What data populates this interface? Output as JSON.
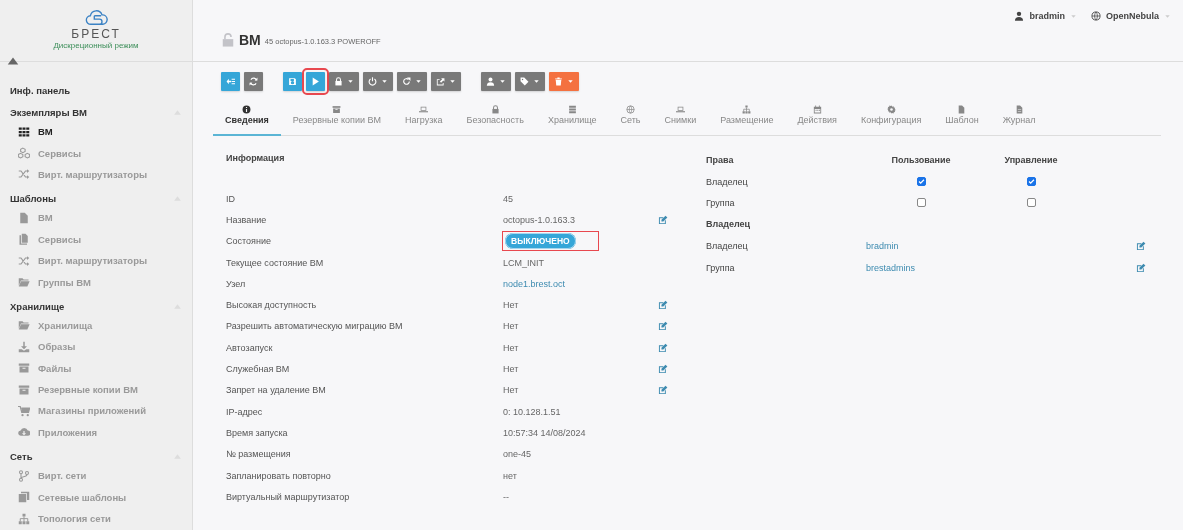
{
  "sidebar": {
    "brand": "БРЕСТ",
    "mode": "Дискреционный режим",
    "items": [
      {
        "label": "Инф. панель"
      },
      {
        "label": "Экземпляры ВМ",
        "children": [
          {
            "label": "ВМ",
            "kind": "grid",
            "selected": true
          },
          {
            "label": "Сервисы",
            "kind": "cubes",
            "selected": false
          },
          {
            "label": "Вирт. маршрутизаторы",
            "kind": "shuffle",
            "selected": false
          }
        ]
      },
      {
        "label": "Шаблоны",
        "children": [
          {
            "label": "ВМ",
            "kind": "file",
            "selected": false
          },
          {
            "label": "Сервисы",
            "kind": "files",
            "selected": false
          },
          {
            "label": "Вирт. маршрутизаторы",
            "kind": "shuffle",
            "selected": false
          },
          {
            "label": "Группы ВМ",
            "kind": "folder",
            "selected": false
          }
        ]
      },
      {
        "label": "Хранилище",
        "children": [
          {
            "label": "Хранилища",
            "kind": "folder",
            "selected": false
          },
          {
            "label": "Образы",
            "kind": "download",
            "selected": false
          },
          {
            "label": "Файлы",
            "kind": "archive",
            "selected": false
          },
          {
            "label": "Резервные копии ВМ",
            "kind": "archive",
            "selected": false
          },
          {
            "label": "Магазины приложений",
            "kind": "cart",
            "selected": false
          },
          {
            "label": "Приложения",
            "kind": "cloud",
            "selected": false
          }
        ]
      },
      {
        "label": "Сеть",
        "children": [
          {
            "label": "Вирт. сети",
            "kind": "branch",
            "selected": false
          },
          {
            "label": "Сетевые шаблоны",
            "kind": "copy",
            "selected": false
          },
          {
            "label": "Топология сети",
            "kind": "sitemap",
            "selected": false
          }
        ]
      }
    ]
  },
  "header": {
    "user": "bradmin",
    "zone": "OpenNebula"
  },
  "title": {
    "name": "ВМ",
    "subtitle": "45 octopus-1.0.163.3 POWEROFF"
  },
  "toolbar": [
    [
      {
        "kind": "back",
        "dropdown": false,
        "highlighted": false
      },
      {
        "kind": "refresh",
        "dropdown": false,
        "highlighted": false
      }
    ],
    [
      {
        "kind": "save",
        "dropdown": false,
        "highlighted": false
      },
      {
        "kind": "play",
        "dropdown": false,
        "highlighted": true
      },
      {
        "kind": "lock",
        "dropdown": true,
        "highlighted": false
      },
      {
        "kind": "power",
        "dropdown": true,
        "highlighted": false
      },
      {
        "kind": "redo",
        "dropdown": true,
        "highlighted": false
      },
      {
        "kind": "export",
        "dropdown": true,
        "highlighted": false
      }
    ],
    [
      {
        "kind": "user",
        "dropdown": true,
        "highlighted": false
      },
      {
        "kind": "tags",
        "dropdown": true,
        "highlighted": false
      },
      {
        "kind": "trash",
        "dropdown": true,
        "highlighted": false
      }
    ]
  ],
  "tabs": [
    {
      "label": "Сведения",
      "kind": "info",
      "selected": true
    },
    {
      "label": "Резервные копии ВМ",
      "kind": "archive",
      "selected": false
    },
    {
      "label": "Нагрузка",
      "kind": "laptop",
      "selected": false
    },
    {
      "label": "Безопасность",
      "kind": "lock",
      "selected": false
    },
    {
      "label": "Хранилище",
      "kind": "database",
      "selected": false
    },
    {
      "label": "Сеть",
      "kind": "globe",
      "selected": false
    },
    {
      "label": "Снимки",
      "kind": "laptop",
      "selected": false
    },
    {
      "label": "Размещение",
      "kind": "sitemap",
      "selected": false
    },
    {
      "label": "Действия",
      "kind": "calendar",
      "selected": false
    },
    {
      "label": "Конфигурация",
      "kind": "gear",
      "selected": false
    },
    {
      "label": "Шаблон",
      "kind": "file",
      "selected": false
    },
    {
      "label": "Журнал",
      "kind": "doc",
      "selected": false
    }
  ],
  "info": {
    "title": "Информация",
    "rows": [
      {
        "label": "ID",
        "value": "45",
        "kind": "text",
        "editable": false,
        "highlighted": false
      },
      {
        "label": "Название",
        "value": "octopus-1.0.163.3",
        "kind": "text",
        "editable": true,
        "highlighted": false
      },
      {
        "label": "Состояние",
        "value": "ВЫКЛЮЧЕНО",
        "kind": "badge",
        "editable": false,
        "highlighted": true
      },
      {
        "label": "Текущее состояние ВМ",
        "value": "LCM_INIT",
        "kind": "text",
        "editable": false,
        "highlighted": false
      },
      {
        "label": "Узел",
        "value": "node1.brest.oct",
        "kind": "link",
        "editable": false,
        "highlighted": false
      },
      {
        "label": "Высокая доступность",
        "value": "Нет",
        "kind": "text",
        "editable": true,
        "highlighted": false
      },
      {
        "label": "Разрешить автоматическую миграцию ВМ",
        "value": "Нет",
        "kind": "text",
        "editable": true,
        "highlighted": false
      },
      {
        "label": "Автозапуск",
        "value": "Нет",
        "kind": "text",
        "editable": true,
        "highlighted": false
      },
      {
        "label": "Служебная ВМ",
        "value": "Нет",
        "kind": "text",
        "editable": true,
        "highlighted": false
      },
      {
        "label": "Запрет на удаление ВМ",
        "value": "Нет",
        "kind": "text",
        "editable": true,
        "highlighted": false
      },
      {
        "label": "IP-адрес",
        "value": "0: 10.128.1.51",
        "kind": "text",
        "editable": false,
        "highlighted": false
      },
      {
        "label": "Время запуска",
        "value": "10:57:34 14/08/2024",
        "kind": "text",
        "editable": false,
        "highlighted": false
      },
      {
        "label": "№ размещения",
        "value": "one-45",
        "kind": "text",
        "editable": false,
        "highlighted": false
      },
      {
        "label": "Запланировать повторно",
        "value": "нет",
        "kind": "text",
        "editable": false,
        "highlighted": false
      },
      {
        "label": "Виртуальный маршрутизатор",
        "value": "--",
        "kind": "text",
        "editable": false,
        "highlighted": false
      }
    ]
  },
  "permissions": {
    "columns": [
      "Права",
      "Пользование",
      "Управление"
    ],
    "rows": [
      {
        "label": "Владелец",
        "use": true,
        "manage": true
      },
      {
        "label": "Группа",
        "use": false,
        "manage": false
      }
    ]
  },
  "ownership": {
    "title": "Владелец",
    "rows": [
      {
        "label": "Владелец",
        "value": "bradmin"
      },
      {
        "label": "Группа",
        "value": "brestadmins"
      }
    ]
  }
}
